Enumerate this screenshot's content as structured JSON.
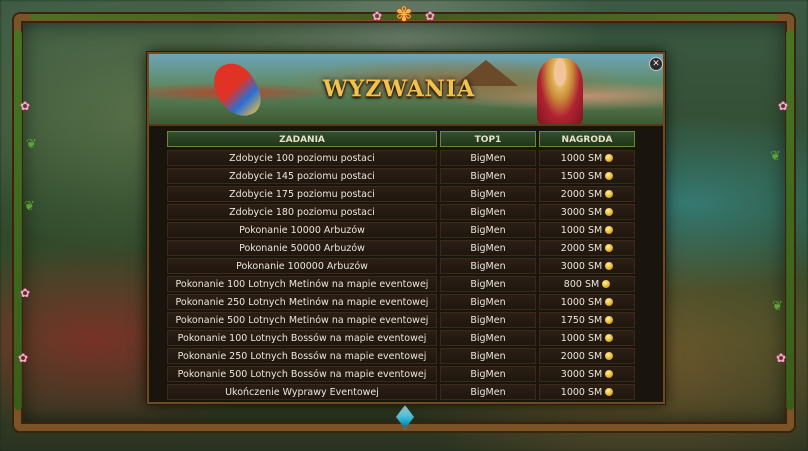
{
  "window": {
    "title": "WYZWANIA",
    "close_glyph": "✕"
  },
  "table": {
    "headers": {
      "task": "ZADANIA",
      "top1": "TOP1",
      "reward": "NAGRODA"
    },
    "rows": [
      {
        "task": "Zdobycie 100 poziomu postaci",
        "top1": "BigMen",
        "reward": "1000 SM"
      },
      {
        "task": "Zdobycie 145 poziomu postaci",
        "top1": "BigMen",
        "reward": "1500 SM"
      },
      {
        "task": "Zdobycie 175 poziomu postaci",
        "top1": "BigMen",
        "reward": "2000 SM"
      },
      {
        "task": "Zdobycie 180 poziomu postaci",
        "top1": "BigMen",
        "reward": "3000 SM"
      },
      {
        "task": "Pokonanie 10000 Arbuzów",
        "top1": "BigMen",
        "reward": "1000 SM"
      },
      {
        "task": "Pokonanie 50000 Arbuzów",
        "top1": "BigMen",
        "reward": "2000 SM"
      },
      {
        "task": "Pokonanie 100000 Arbuzów",
        "top1": "BigMen",
        "reward": "3000 SM"
      },
      {
        "task": "Pokonanie 100 Lotnych Metinów na mapie eventowej",
        "top1": "BigMen",
        "reward": "800 SM"
      },
      {
        "task": "Pokonanie 250 Lotnych Metinów na mapie eventowej",
        "top1": "BigMen",
        "reward": "1000 SM"
      },
      {
        "task": "Pokonanie 500 Lotnych Metinów na mapie eventowej",
        "top1": "BigMen",
        "reward": "1750 SM"
      },
      {
        "task": "Pokonanie 100 Lotnych Bossów na mapie eventowej",
        "top1": "BigMen",
        "reward": "1000 SM"
      },
      {
        "task": "Pokonanie 250 Lotnych Bossów na mapie eventowej",
        "top1": "BigMen",
        "reward": "2000 SM"
      },
      {
        "task": "Pokonanie 500 Lotnych Bossów na mapie eventowej",
        "top1": "BigMen",
        "reward": "3000 SM"
      },
      {
        "task": "Ukończenie Wyprawy Eventowej",
        "top1": "BigMen",
        "reward": "1000 SM"
      }
    ]
  },
  "icons": {
    "coin": "sm-coin-icon",
    "close": "close-icon",
    "top_ornament": "lotus-ornament-icon",
    "bottom_gem": "gem-icon"
  },
  "colors": {
    "title": "#f2c14e",
    "frame": "#7a5426",
    "header_bg": "#33502b",
    "row_bg": "#2b1f15",
    "coin": "#e8b730"
  }
}
